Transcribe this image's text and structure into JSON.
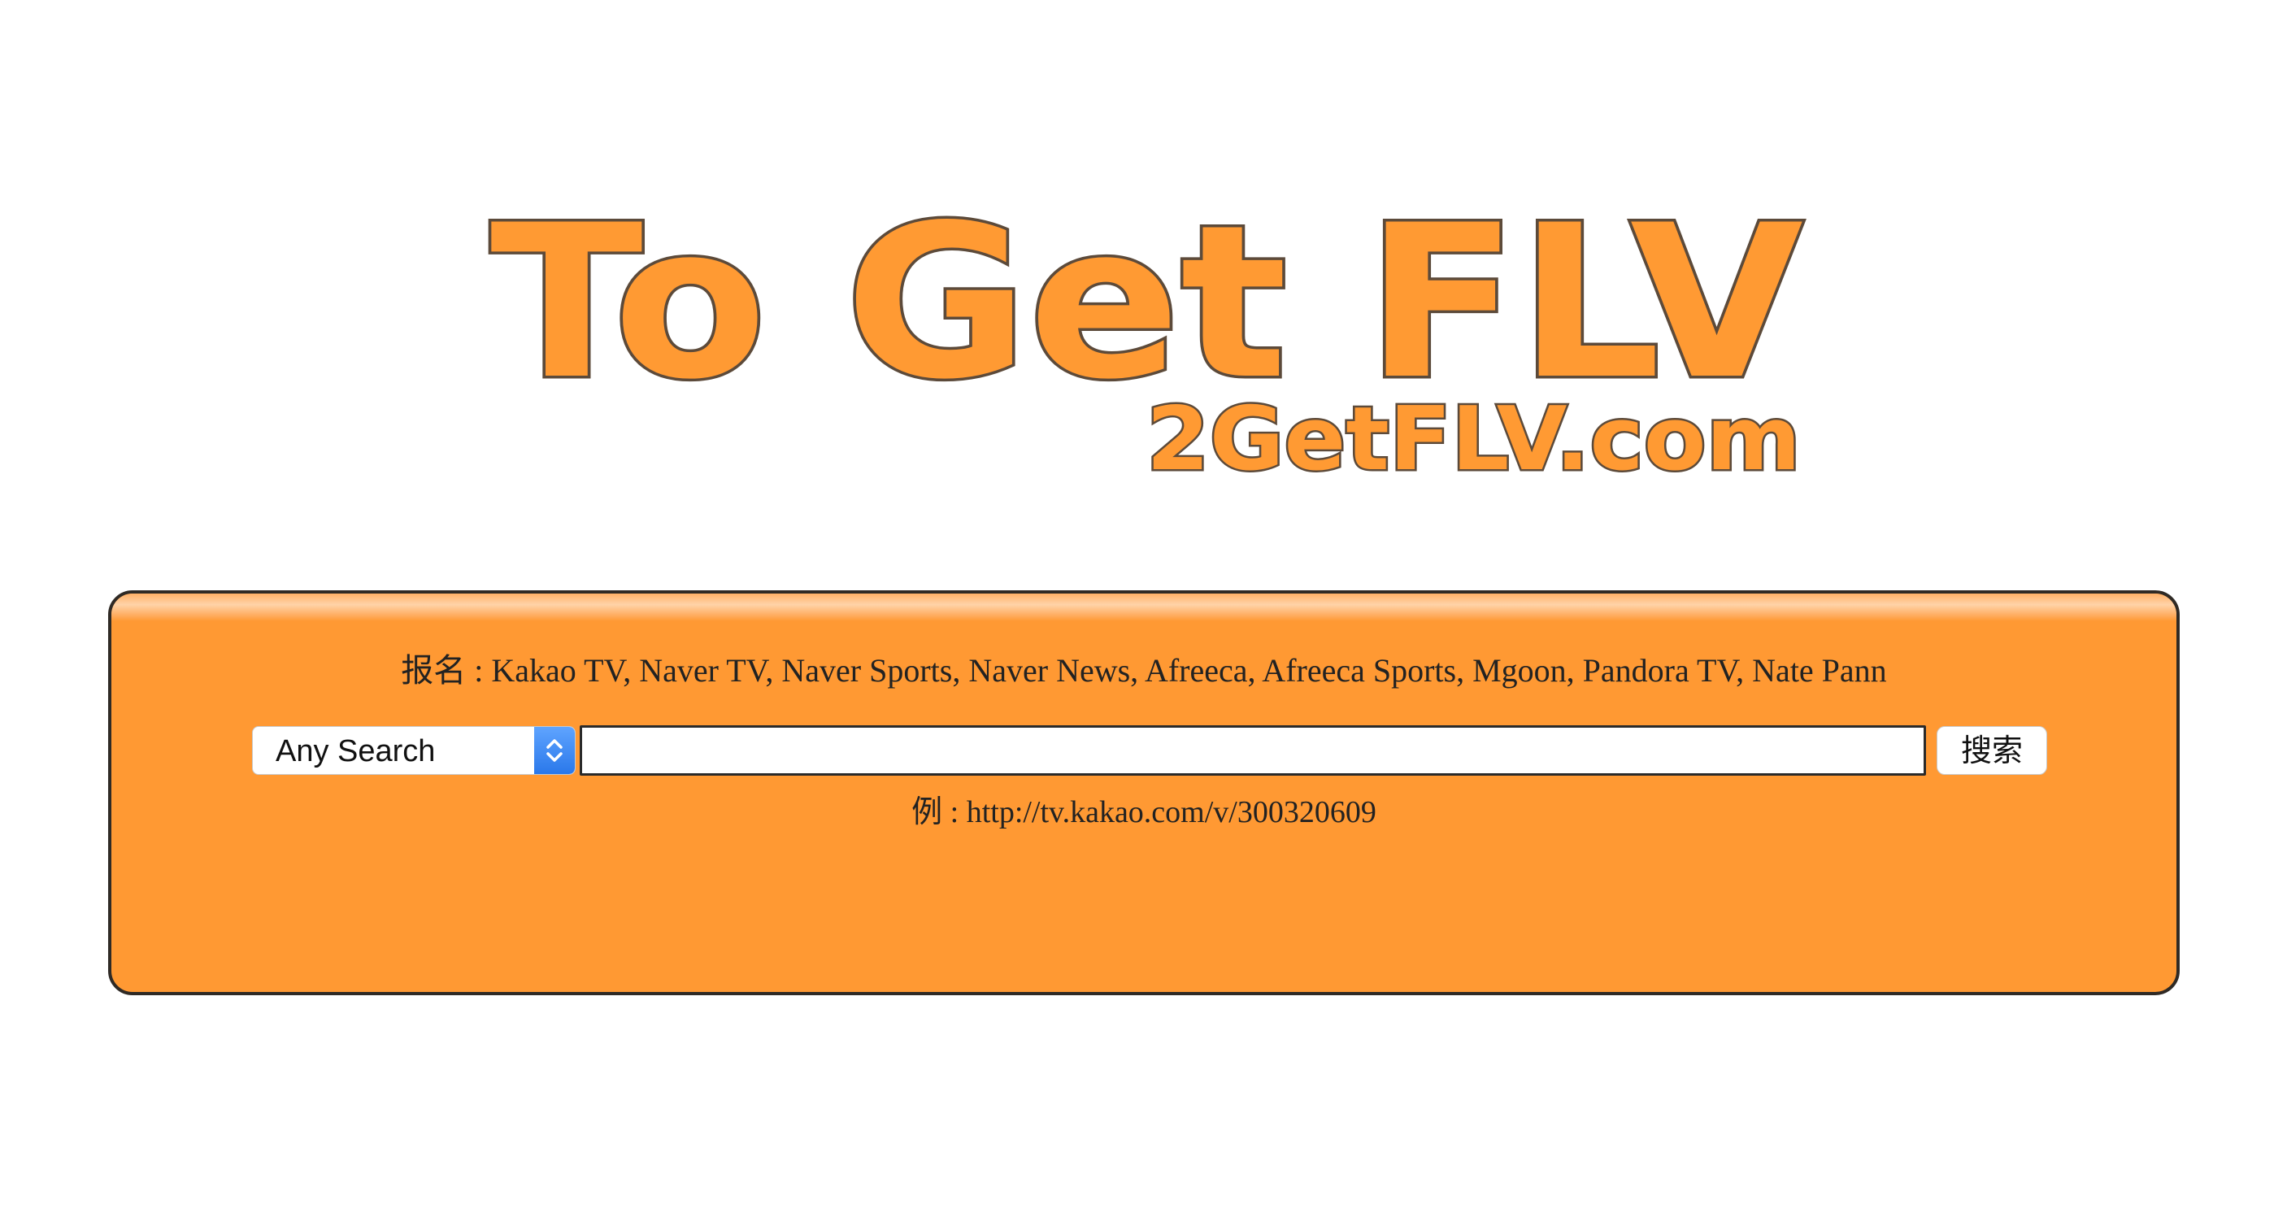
{
  "logo": {
    "title": "To Get FLV",
    "subtitle": "2GetFLV.com"
  },
  "panel": {
    "supported_text": "报名 : Kakao TV, Naver TV, Naver Sports, Naver News, Afreeca, Afreeca Sports, Mgoon, Pandora TV, Nate Pann",
    "select": {
      "selected": "Any Search"
    },
    "url_input": {
      "value": "",
      "placeholder": ""
    },
    "search_button_label": "搜索",
    "example_text": "例 : http://tv.kakao.com/v/300320609"
  },
  "colors": {
    "accent": "#ff9933",
    "logo_fill": "#ff9a33",
    "logo_stroke": "#5c4a3a",
    "select_arrow": "#3b86f5"
  },
  "icons": {
    "select_arrows": "chevron-up-down-icon"
  }
}
